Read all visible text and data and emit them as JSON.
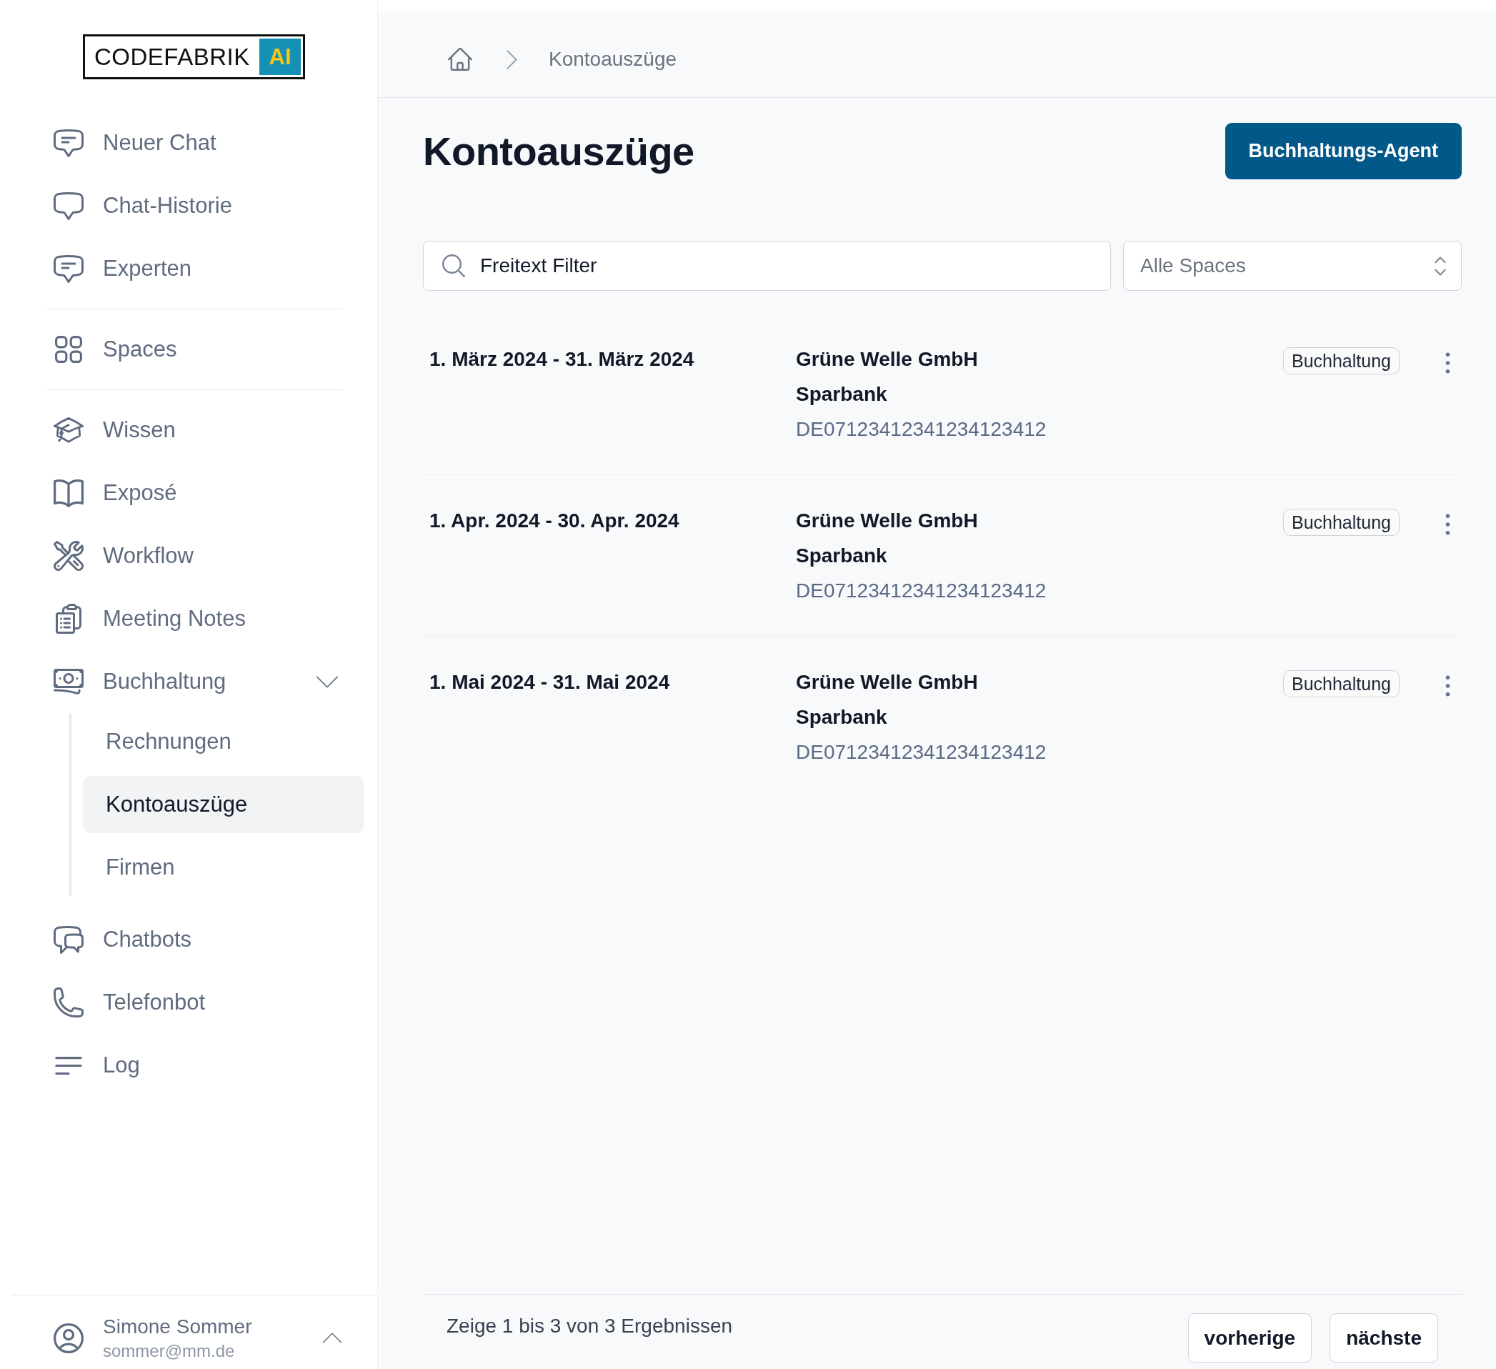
{
  "sidebar": {
    "logo": {
      "wordmark": "CODEFABRIK",
      "badge": "AI"
    },
    "sections": [
      {
        "items": [
          {
            "label": "Neuer Chat",
            "selected": false
          },
          {
            "label": "Chat-Historie",
            "selected": false
          },
          {
            "label": "Experten",
            "selected": false
          }
        ]
      },
      {
        "items": [
          {
            "label": "Spaces",
            "selected": false
          }
        ]
      },
      {
        "items": [
          {
            "label": "Wissen",
            "selected": false
          },
          {
            "label": "Exposé",
            "selected": false
          },
          {
            "label": "Workflow",
            "selected": false
          },
          {
            "label": "Meeting Notes",
            "selected": false
          },
          {
            "label": "Buchhaltung",
            "selected": false,
            "expanded": true,
            "children": [
              {
                "label": "Rechnungen",
                "selected": false
              },
              {
                "label": "Kontoauszüge",
                "selected": true
              },
              {
                "label": "Firmen",
                "selected": false
              }
            ]
          },
          {
            "label": "Chatbots",
            "selected": false
          },
          {
            "label": "Telefonbot",
            "selected": false
          },
          {
            "label": "Log",
            "selected": false
          }
        ]
      }
    ],
    "user": {
      "name": "Simone Sommer",
      "email": "sommer@mm.de"
    }
  },
  "breadcrumb": [
    "Kontoauszüge"
  ],
  "page": {
    "title": "Kontoauszüge",
    "action_button": "Buchhaltungs-Agent"
  },
  "filters": {
    "search": {
      "placeholder": "Freitext Filter"
    },
    "space_select": {
      "value": "Alle Spaces"
    }
  },
  "statements": [
    {
      "period": "1. März 2024 - 31. März 2024",
      "company": "Grüne Welle GmbH",
      "bank": "Sparbank",
      "iban": "DE07123412341234123412",
      "tag": "Buchhaltung"
    },
    {
      "period": "1. Apr. 2024 - 30. Apr. 2024",
      "company": "Grüne Welle GmbH",
      "bank": "Sparbank",
      "iban": "DE07123412341234123412",
      "tag": "Buchhaltung"
    },
    {
      "period": "1. Mai 2024 - 31. Mai 2024",
      "company": "Grüne Welle GmbH",
      "bank": "Sparbank",
      "iban": "DE07123412341234123412",
      "tag": "Buchhaltung"
    }
  ],
  "pagination": {
    "summary": "Zeige 1 bis 3 von 3 Ergebnissen",
    "buttons": [
      "vorherige",
      "nächste"
    ]
  }
}
